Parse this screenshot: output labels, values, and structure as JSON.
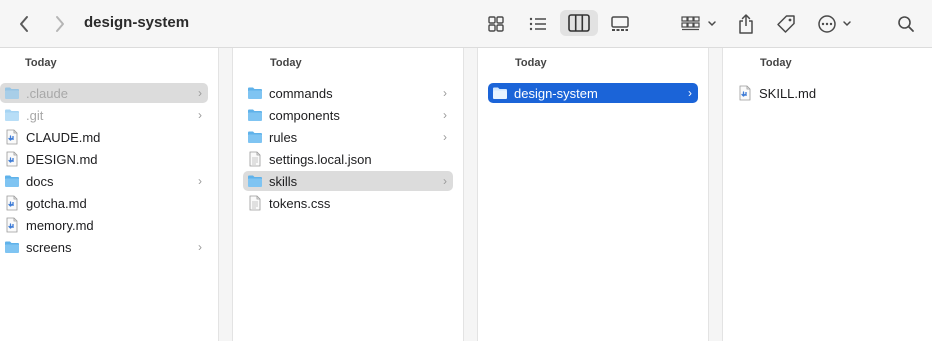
{
  "window": {
    "title": "design-system"
  },
  "toolbar": {
    "icons": [
      "chevron-left-icon",
      "chevron-right-icon",
      "icon-view-icon",
      "list-view-icon",
      "column-view-icon",
      "gallery-view-icon",
      "group-icon",
      "share-icon",
      "tag-icon",
      "more-icon",
      "search-icon"
    ]
  },
  "columns": [
    {
      "header": "Today",
      "items": [
        {
          "name": ".claude",
          "type": "folder",
          "chevron": "›",
          "state": "selected-inactive",
          "dim": true
        },
        {
          "name": ".git",
          "type": "folder",
          "chevron": "›",
          "dim": true
        },
        {
          "name": "CLAUDE.md",
          "type": "file-md"
        },
        {
          "name": "DESIGN.md",
          "type": "file-md"
        },
        {
          "name": "docs",
          "type": "folder",
          "chevron": "›"
        },
        {
          "name": "gotcha.md",
          "type": "file-md"
        },
        {
          "name": "memory.md",
          "type": "file-md"
        },
        {
          "name": "screens",
          "type": "folder",
          "chevron": "›"
        }
      ]
    },
    {
      "header": "Today",
      "items": [
        {
          "name": "commands",
          "type": "folder",
          "chevron": "›"
        },
        {
          "name": "components",
          "type": "folder",
          "chevron": "›"
        },
        {
          "name": "rules",
          "type": "folder",
          "chevron": "›"
        },
        {
          "name": "settings.local.json",
          "type": "file-doc"
        },
        {
          "name": "skills",
          "type": "folder",
          "chevron": "›",
          "state": "selected-inactive"
        },
        {
          "name": "tokens.css",
          "type": "file-doc"
        }
      ]
    },
    {
      "header": "Today",
      "items": [
        {
          "name": "design-system",
          "type": "folder",
          "chevron": "›",
          "state": "selected-active"
        }
      ]
    },
    {
      "header": "Today",
      "items": [
        {
          "name": "SKILL.md",
          "type": "file-md"
        }
      ]
    }
  ],
  "colors": {
    "accent": "#1b64d8",
    "folder": "#5fb2ea",
    "selection_inactive": "#dcdcdc"
  }
}
